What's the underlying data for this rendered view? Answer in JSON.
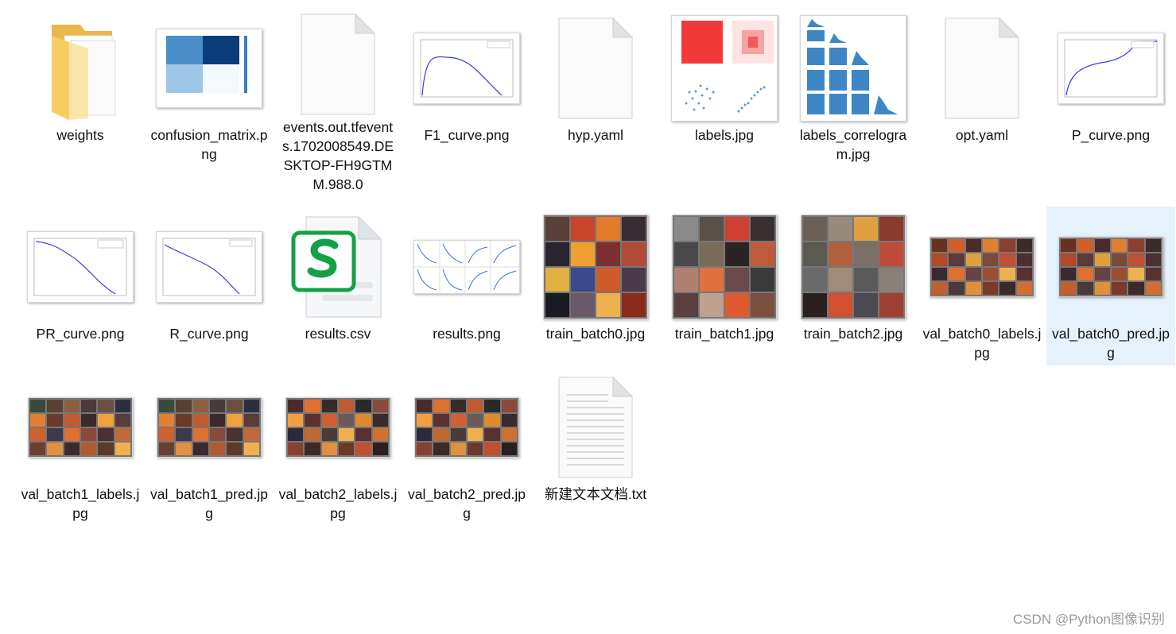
{
  "files": [
    {
      "name": "weights",
      "type": "folder"
    },
    {
      "name": "confusion_matrix.png",
      "type": "confusion"
    },
    {
      "name": "events.out.tfevents.1702008549.DESKTOP-FH9GTMM.988.0",
      "type": "blank"
    },
    {
      "name": "F1_curve.png",
      "type": "curve-f1"
    },
    {
      "name": "hyp.yaml",
      "type": "blank"
    },
    {
      "name": "labels.jpg",
      "type": "labels"
    },
    {
      "name": "labels_correlogram.jpg",
      "type": "correlogram"
    },
    {
      "name": "opt.yaml",
      "type": "blank"
    },
    {
      "name": "P_curve.png",
      "type": "curve-p"
    },
    {
      "name": "PR_curve.png",
      "type": "curve-pr"
    },
    {
      "name": "R_curve.png",
      "type": "curve-r"
    },
    {
      "name": "results.csv",
      "type": "csv"
    },
    {
      "name": "results.png",
      "type": "results"
    },
    {
      "name": "train_batch0.jpg",
      "type": "train"
    },
    {
      "name": "train_batch1.jpg",
      "type": "train"
    },
    {
      "name": "train_batch2.jpg",
      "type": "train"
    },
    {
      "name": "val_batch0_labels.jpg",
      "type": "val"
    },
    {
      "name": "val_batch0_pred.jpg",
      "type": "val",
      "selected": true
    },
    {
      "name": "val_batch1_labels.jpg",
      "type": "val"
    },
    {
      "name": "val_batch1_pred.jpg",
      "type": "val"
    },
    {
      "name": "val_batch2_labels.jpg",
      "type": "val"
    },
    {
      "name": "val_batch2_pred.jpg",
      "type": "val"
    },
    {
      "name": "新建文本文档.txt",
      "type": "txt"
    }
  ],
  "watermark": "CSDN @Python图像识别",
  "colors": {
    "selection": "#e5f1fb",
    "folder": "#f6cd63",
    "csv_green": "#15a046",
    "curve_line": "#3a3ae8"
  }
}
